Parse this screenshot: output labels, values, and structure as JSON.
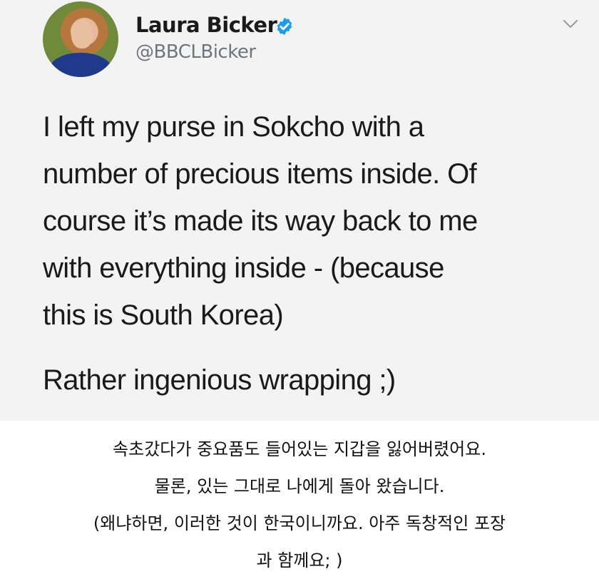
{
  "tweet": {
    "author": {
      "display_name": "Laura Bicker",
      "handle": "@BBCLBicker",
      "verified": true,
      "verified_icon": "verified-badge-icon",
      "avatar": "profile-photo"
    },
    "menu_icon": "chevron-down-icon",
    "body_lines": [
      "I left my purse in Sokcho with a",
      "number of precious items inside. Of",
      "course it’s made its way back to me",
      "with everything inside - (because",
      "this is South Korea)"
    ],
    "body_line_2": "Rather ingenious wrapping ;)",
    "colors": {
      "card_background": "#f3f3f4",
      "verified_blue": "#1d9bf0",
      "handle_gray": "#6e767d",
      "text": "#1a1a1a"
    }
  },
  "caption": {
    "lines": [
      "속초갔다가 중요품도 들어있는 지갑을 잃어버렸어요.",
      "물론, 있는 그대로 나에게  돌아 왔습니다.",
      "(왜냐하면, 이러한 것이 한국이니까요. 아주 독창적인 포장",
      "과 함께요; )"
    ]
  }
}
